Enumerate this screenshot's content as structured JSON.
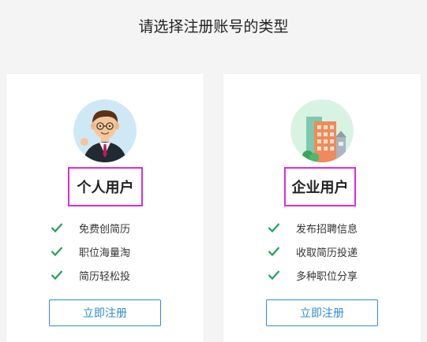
{
  "page": {
    "title": "请选择注册账号的类型"
  },
  "cards": [
    {
      "type_label": "个人用户",
      "avatar_icon": "businessman-avatar-icon",
      "features": [
        "免费创简历",
        "职位海量淘",
        "简历轻松投"
      ],
      "register_label": "立即注册"
    },
    {
      "type_label": "企业用户",
      "avatar_icon": "office-building-icon",
      "features": [
        "发布招聘信息",
        "收取简历投递",
        "多种职位分享"
      ],
      "register_label": "立即注册"
    }
  ],
  "colors": {
    "accent": "#2f8bd3",
    "check": "#23a05a",
    "highlight_border": "#e22ad6"
  }
}
